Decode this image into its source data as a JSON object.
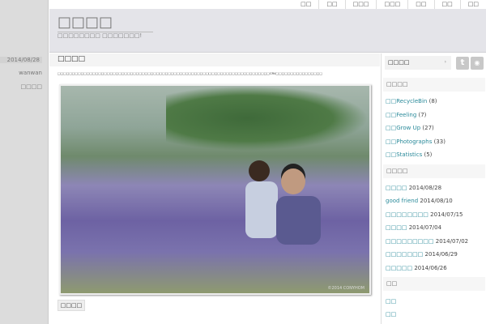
{
  "top_nav": [
    "□□",
    "□□",
    "□□□",
    "□□□",
    "□□",
    "□□",
    "□□"
  ],
  "site": {
    "title": "□□□□",
    "subtitle": "□□□□□□□□ □□□□□□□!"
  },
  "post": {
    "date": "2014/08/28",
    "author": "wanwan",
    "category": "□□□□",
    "title": "□□□□",
    "text": "□□□□□□□□□□□□□□□□□□□□□□□□□□□□□□□□□□□□□□□□□□□□□□□□□□□□□□□□□□□□□□□□□□□□□□□□□CRV□□□□□□□□□□□□□□□□",
    "photo_watermark": "©2014 CONYHOM",
    "more_label": "□□□□"
  },
  "sidebar": {
    "select_label": "□□□□",
    "select_arrow": "›",
    "twitter": "t",
    "rss": "◉",
    "categories_title": "□□□□",
    "categories": [
      {
        "prefix": "□□",
        "name": "RecycleBin",
        "count": "(8)"
      },
      {
        "prefix": "□□",
        "name": "Feeling",
        "count": "(7)"
      },
      {
        "prefix": "□□",
        "name": "Grow Up",
        "count": "(27)"
      },
      {
        "prefix": "□□",
        "name": "Photographs",
        "count": "(33)"
      },
      {
        "prefix": "□□",
        "name": "Statistics",
        "count": "(5)"
      }
    ],
    "recent_title": "□□□□",
    "recent": [
      {
        "title": "□□□□",
        "date": "2014/08/28"
      },
      {
        "title": "good friend",
        "date": "2014/08/10"
      },
      {
        "title": "□□□□□□□□",
        "date": "2014/07/15"
      },
      {
        "title": "□□□□",
        "date": "2014/07/04"
      },
      {
        "title": "□□□□□□□□□",
        "date": "2014/07/02"
      },
      {
        "title": "□□□□□□□",
        "date": "2014/06/29"
      },
      {
        "title": "□□□□□",
        "date": "2014/06/26"
      }
    ],
    "links_title": "□□",
    "links": [
      "□□",
      "□□"
    ]
  }
}
